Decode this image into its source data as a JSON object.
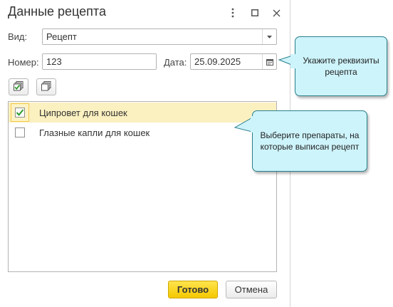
{
  "dialog": {
    "title": "Данные рецепта",
    "more_icon": "more-vertical-icon",
    "maximize_icon": "maximize-icon",
    "close_icon": "close-icon"
  },
  "form": {
    "kind_label": "Вид:",
    "kind_value": "Рецепт",
    "number_label": "Номер:",
    "number_value": "123",
    "date_label": "Дата:",
    "date_value": "25.09.2025"
  },
  "toolbar": {
    "check_all_icon": "check-all-icon",
    "uncheck_all_icon": "uncheck-all-icon"
  },
  "list": {
    "items": [
      {
        "label": "Ципровет для кошек",
        "checked": true,
        "selected": true
      },
      {
        "label": "Глазные капли для кошек",
        "checked": false,
        "selected": false
      }
    ]
  },
  "buttons": {
    "ok_label": "Готово",
    "cancel_label": "Отмена"
  },
  "tooltips": {
    "requisites": "Укажите реквизиты рецепта",
    "preparations": "Выберите препараты, на которые выписан рецепт"
  },
  "colors": {
    "accent_button": "#f5c800",
    "tooltip_bg": "#cdf4fb",
    "tooltip_border": "#2a7f8c",
    "selected_row": "#fbf0c0",
    "checkmark": "#2e9a2e"
  }
}
